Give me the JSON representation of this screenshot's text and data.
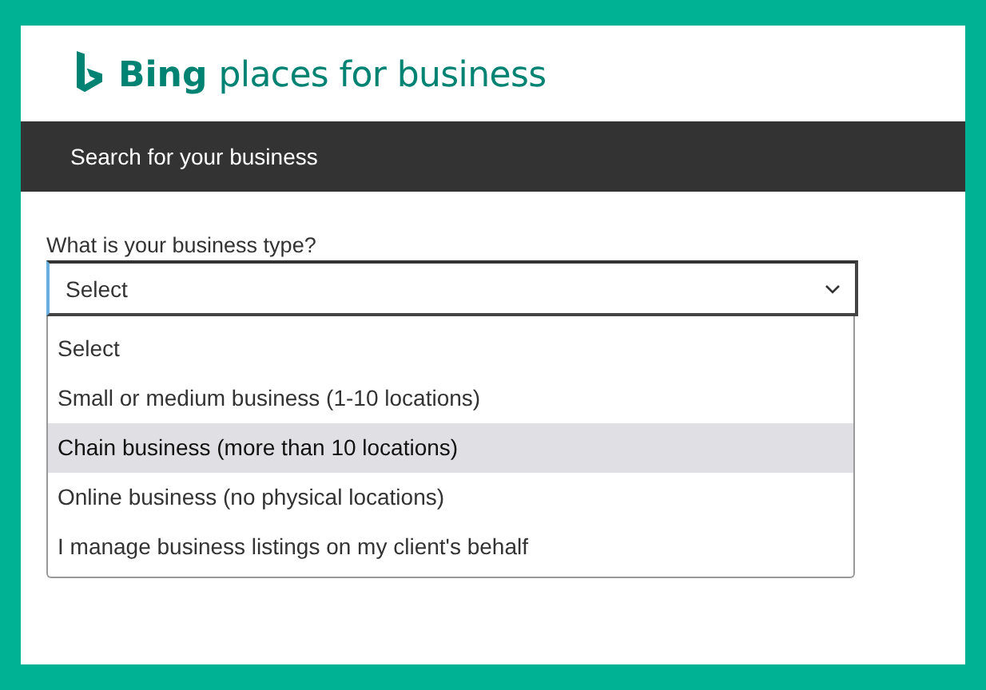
{
  "header": {
    "brand": "Bing",
    "tagline": "places for business"
  },
  "nav_bar": {
    "title": "Search for your business"
  },
  "form": {
    "label": "What is your business type?",
    "value": "Select",
    "expanded": true
  },
  "options": [
    {
      "label": "Select",
      "selected": false
    },
    {
      "label": "Small or medium business (1-10 locations)",
      "selected": false
    },
    {
      "label": "Chain business (more than 10 locations)",
      "selected": true
    },
    {
      "label": "Online business (no physical locations)",
      "selected": false
    },
    {
      "label": "I manage business listings on my client's behalf",
      "selected": false
    }
  ]
}
